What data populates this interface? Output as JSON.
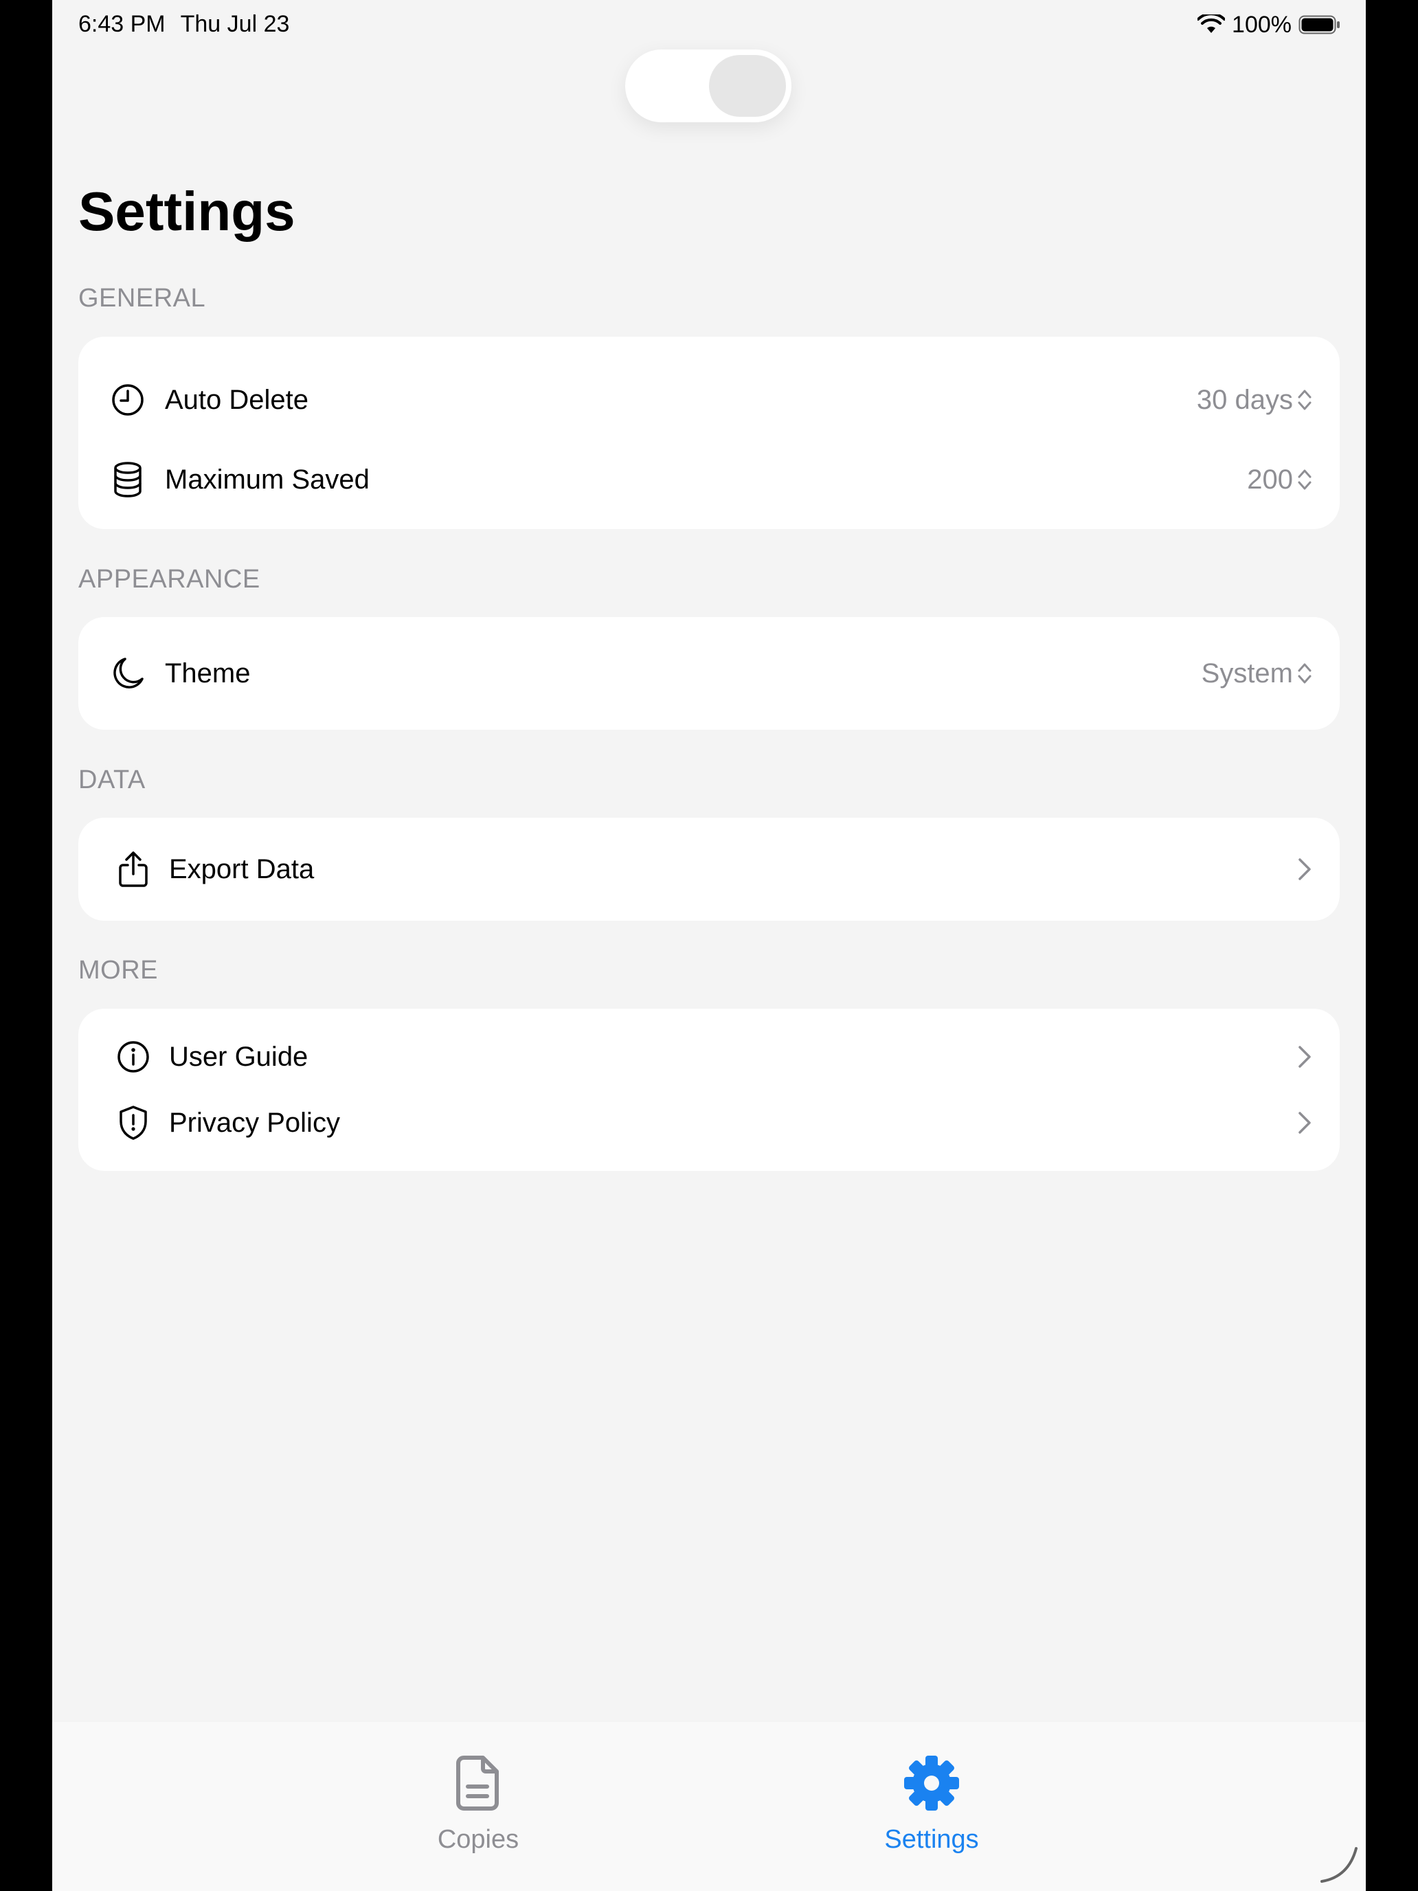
{
  "status_bar": {
    "time": "6:43 PM",
    "date": "Thu Jul 23",
    "battery": "100%"
  },
  "page": {
    "title": "Settings"
  },
  "sections": {
    "general": {
      "header": "GENERAL",
      "auto_delete": {
        "label": "Auto Delete",
        "value": "30 days",
        "icon": "clock-icon"
      },
      "maximum_saved": {
        "label": "Maximum Saved",
        "value": "200",
        "icon": "database-icon"
      }
    },
    "appearance": {
      "header": "APPEARANCE",
      "theme": {
        "label": "Theme",
        "value": "System",
        "icon": "moon-icon"
      }
    },
    "data": {
      "header": "DATA",
      "export": {
        "label": "Export Data",
        "icon": "share-icon"
      }
    },
    "more": {
      "header": "MORE",
      "user_guide": {
        "label": "User Guide",
        "icon": "info-icon"
      },
      "privacy_policy": {
        "label": "Privacy Policy",
        "icon": "shield-icon"
      }
    }
  },
  "tab_bar": {
    "tabs": [
      {
        "label": "Copies",
        "icon": "document-icon",
        "active": false
      },
      {
        "label": "Settings",
        "icon": "gear-icon",
        "active": true
      }
    ]
  },
  "colors": {
    "accent": "#1a82f0",
    "secondary_text": "#8e8e93",
    "background": "#f4f4f4",
    "card": "#ffffff"
  }
}
